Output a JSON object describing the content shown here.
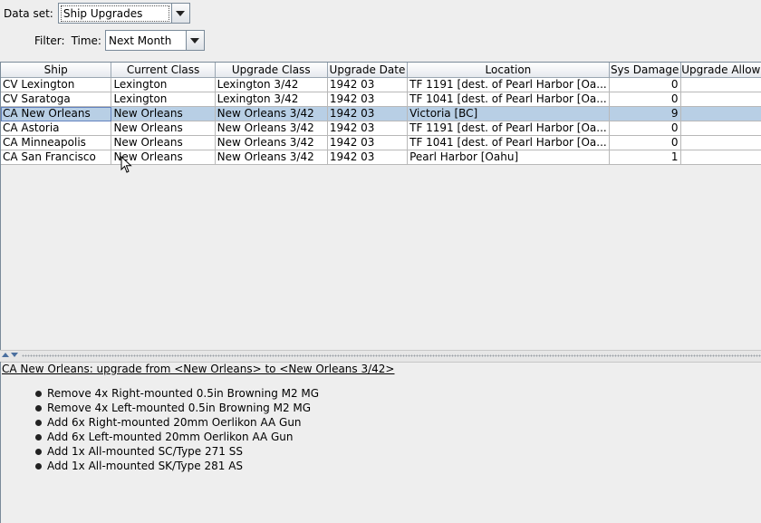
{
  "dataset": {
    "label": "Data set:",
    "value": "Ship Upgrades"
  },
  "filter": {
    "label": "Filter:",
    "time_label": "Time:",
    "time_value": "Next Month"
  },
  "table": {
    "columns": [
      "Ship",
      "Current Class",
      "Upgrade Class",
      "Upgrade Date",
      "Location",
      "Sys Damage",
      "Upgrade Allow"
    ],
    "rows": [
      [
        "CV Lexington",
        "Lexington",
        "Lexington 3/42",
        "1942 03",
        "TF 1191 [dest. of Pearl Harbor [Oa...",
        "0",
        ""
      ],
      [
        "CV Saratoga",
        "Lexington",
        "Lexington 3/42",
        "1942 03",
        "TF 1041 [dest. of Pearl Harbor [Oa...",
        "0",
        ""
      ],
      [
        "CA New Orleans",
        "New Orleans",
        "New Orleans 3/42",
        "1942 03",
        "Victoria [BC]",
        "9",
        ""
      ],
      [
        "CA Astoria",
        "New Orleans",
        "New Orleans 3/42",
        "1942 03",
        "TF 1191 [dest. of Pearl Harbor [Oa...",
        "0",
        ""
      ],
      [
        "CA Minneapolis",
        "New Orleans",
        "New Orleans 3/42",
        "1942 03",
        "TF 1041 [dest. of Pearl Harbor [Oa...",
        "0",
        ""
      ],
      [
        "CA San Francisco",
        "New Orleans",
        "New Orleans 3/42",
        "1942 03",
        "Pearl Harbor [Oahu]",
        "1",
        ""
      ]
    ],
    "selected_row": 2
  },
  "detail": {
    "title": "CA New Orleans: upgrade from <New Orleans> to <New Orleans 3/42>",
    "items": [
      "Remove 4x Right-mounted 0.5in Browning M2 MG",
      "Remove 4x Left-mounted 0.5in Browning M2 MG",
      "Add 6x Right-mounted 20mm Oerlikon AA Gun",
      "Add 6x Left-mounted 20mm Oerlikon AA Gun",
      "Add 1x All-mounted SC/Type 271 SS",
      "Add 1x All-mounted SK/Type 281 AS"
    ]
  },
  "colors": {
    "selection": "#b8cfe5",
    "border": "#7a8a99",
    "background": "#eeeeee"
  }
}
